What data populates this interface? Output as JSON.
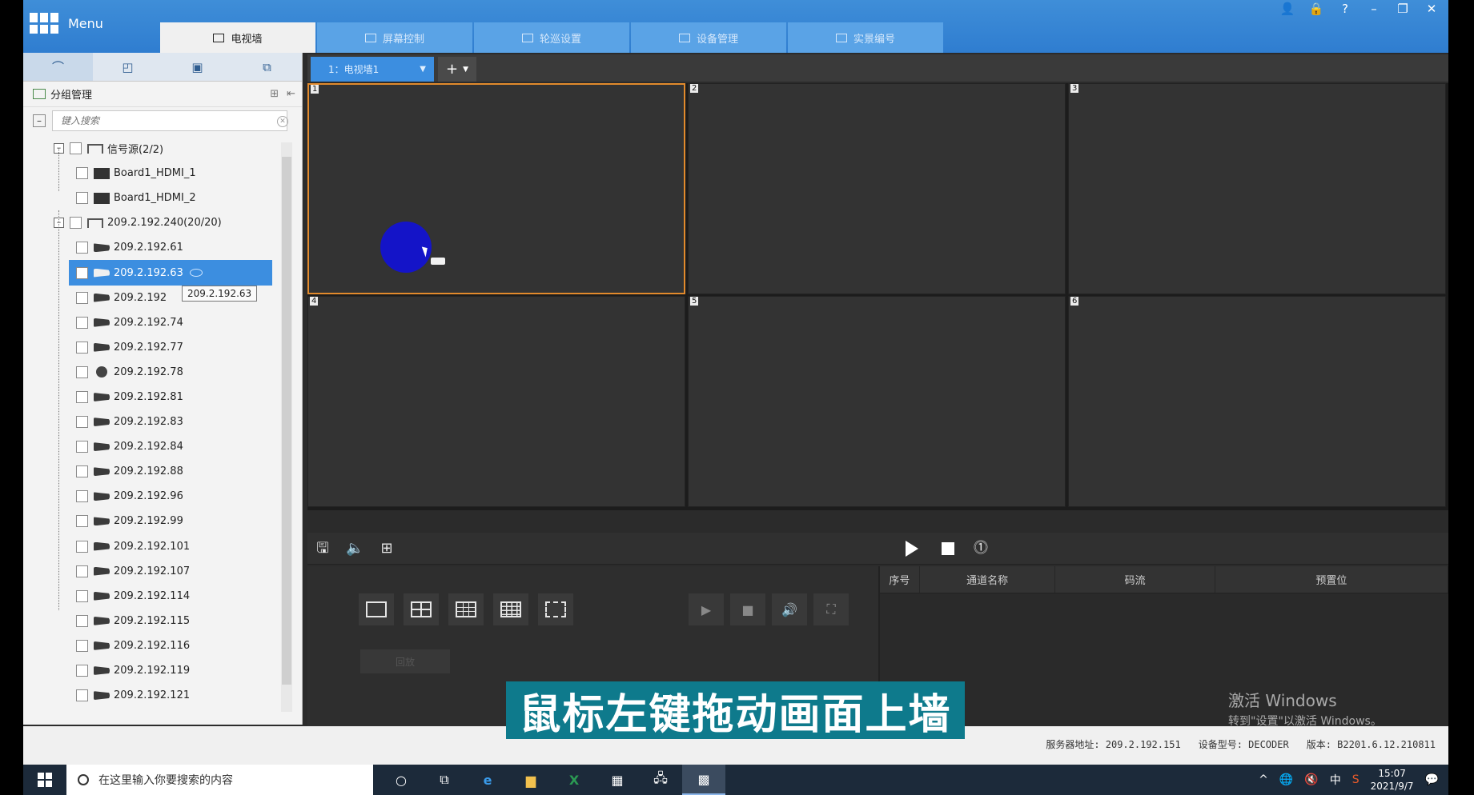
{
  "app": {
    "menu_label": "Menu",
    "tabs": [
      {
        "label": "电视墙",
        "icon": "grid-icon",
        "active": true
      },
      {
        "label": "屏幕控制",
        "icon": "monitor-icon",
        "active": false
      },
      {
        "label": "轮巡设置",
        "icon": "cycle-icon",
        "active": false
      },
      {
        "label": "设备管理",
        "icon": "device-icon",
        "active": false
      },
      {
        "label": "实景编号",
        "icon": "list-icon",
        "active": false
      }
    ],
    "window_controls": [
      "user-icon",
      "lock-icon",
      "help-icon",
      "minimize-icon",
      "restore-icon",
      "close-icon"
    ]
  },
  "left_panel": {
    "group_title": "分组管理",
    "search_placeholder": "键入搜索",
    "tooltip": "209.2.192.63",
    "tree": [
      {
        "label": "信号源(2/2)",
        "type": "group",
        "level": 0
      },
      {
        "label": "Board1_HDMI_1",
        "type": "hdmi",
        "level": 1
      },
      {
        "label": "Board1_HDMI_2",
        "type": "hdmi",
        "level": 1
      },
      {
        "label": "209.2.192.240(20/20)",
        "type": "group",
        "level": 0
      },
      {
        "label": "209.2.192.61",
        "type": "camera",
        "level": 1
      },
      {
        "label": "209.2.192.63",
        "type": "camera",
        "level": 1,
        "selected": true
      },
      {
        "label": "209.2.192",
        "type": "camera",
        "level": 1
      },
      {
        "label": "209.2.192.74",
        "type": "camera",
        "level": 1
      },
      {
        "label": "209.2.192.77",
        "type": "camera",
        "level": 1
      },
      {
        "label": "209.2.192.78",
        "type": "dome",
        "level": 1
      },
      {
        "label": "209.2.192.81",
        "type": "camera",
        "level": 1
      },
      {
        "label": "209.2.192.83",
        "type": "camera",
        "level": 1
      },
      {
        "label": "209.2.192.84",
        "type": "camera",
        "level": 1
      },
      {
        "label": "209.2.192.88",
        "type": "camera",
        "level": 1
      },
      {
        "label": "209.2.192.96",
        "type": "camera",
        "level": 1
      },
      {
        "label": "209.2.192.99",
        "type": "camera",
        "level": 1
      },
      {
        "label": "209.2.192.101",
        "type": "camera",
        "level": 1
      },
      {
        "label": "209.2.192.107",
        "type": "camera",
        "level": 1
      },
      {
        "label": "209.2.192.114",
        "type": "camera",
        "level": 1
      },
      {
        "label": "209.2.192.115",
        "type": "camera",
        "level": 1
      },
      {
        "label": "209.2.192.116",
        "type": "camera",
        "level": 1
      },
      {
        "label": "209.2.192.119",
        "type": "camera",
        "level": 1
      },
      {
        "label": "209.2.192.121",
        "type": "camera",
        "level": 1
      }
    ]
  },
  "wall": {
    "selector_label": "1：电视墙1",
    "cells": [
      "1",
      "2",
      "3",
      "4",
      "5",
      "6"
    ],
    "active_cell": "1"
  },
  "bottom": {
    "disabled_button": "回放",
    "table_headers": [
      "序号",
      "通道名称",
      "码流",
      "预置位"
    ]
  },
  "status": {
    "server": "服务器地址: 209.2.192.151",
    "device": "设备型号: DECODER",
    "version": "版本: B2201.6.12.210811"
  },
  "watermark": {
    "line1": "激活 Windows",
    "line2": "转到\"设置\"以激活 Windows。"
  },
  "subtitle": "鼠标左键拖动画面上墙",
  "taskbar": {
    "search_text": "在这里输入你要搜索的内容",
    "time": "15:07",
    "date": "2021/9/7",
    "ime": "中"
  }
}
